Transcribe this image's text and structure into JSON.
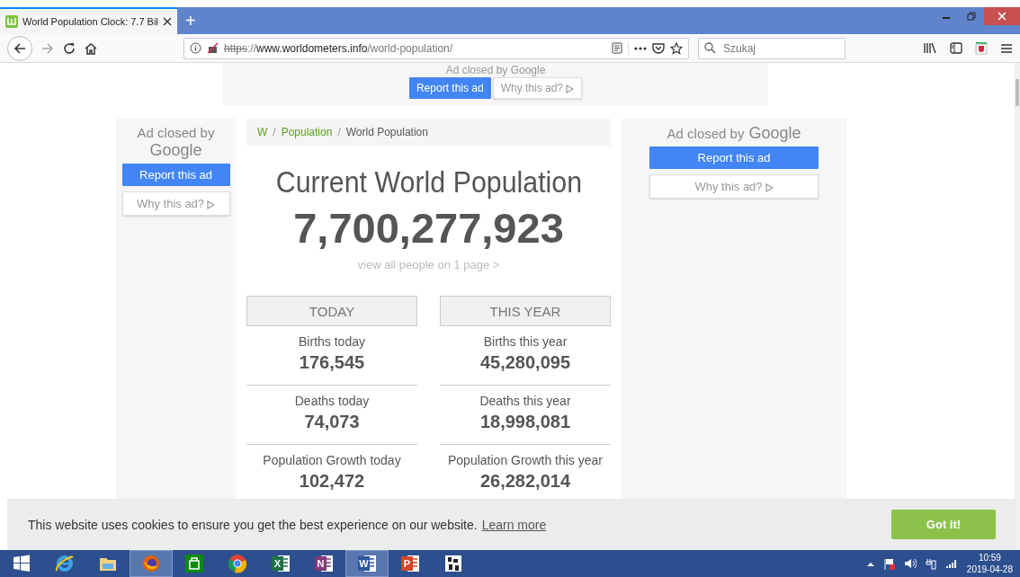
{
  "browser": {
    "tabs": [
      {
        "title": "World Population Clock: 7.7 Bil",
        "selected": true
      }
    ],
    "new_tab": "+",
    "url": {
      "scheme": "https",
      "separator": "://",
      "host": "www.worldometers.info",
      "path": "/world-population/"
    },
    "search": {
      "placeholder": "Szukaj"
    }
  },
  "top_ad": {
    "text": "Ad closed by Google",
    "report": "Report this ad",
    "why": "Why this ad?"
  },
  "left_ad": {
    "text": "Ad closed by",
    "brand": "Google",
    "report": "Report this ad",
    "why": "Why this ad?"
  },
  "breadcrumb_separator": "/",
  "breadcrumb": [
    {
      "label": "W",
      "kind": "link"
    },
    {
      "label": "Population",
      "kind": "link"
    },
    {
      "label": "World Population",
      "kind": "current"
    }
  ],
  "title": "Current World Population",
  "counter": "7,700,277,923",
  "view_all": "view all people on 1 page >",
  "columns": [
    {
      "heading": "TODAY",
      "stats": [
        {
          "label": "Births today",
          "value": "176,545"
        },
        {
          "label": "Deaths today",
          "value": "74,073"
        },
        {
          "label": "Population Growth today",
          "value": "102,472"
        }
      ]
    },
    {
      "heading": "THIS YEAR",
      "stats": [
        {
          "label": "Births this year",
          "value": "45,280,095"
        },
        {
          "label": "Deaths this year",
          "value": "18,998,081"
        },
        {
          "label": "Population Growth this year",
          "value": "26,282,014"
        }
      ]
    }
  ],
  "right_ad": {
    "text": "Ad closed by",
    "brand": "Google",
    "report": "Report this ad",
    "why": "Why this ad?"
  },
  "cookie": {
    "message": "This website uses cookies to ensure you get the best experience on our website.",
    "link": "Learn more",
    "button": "Got it!"
  },
  "taskbar": {
    "apps": [
      {
        "kind": "ie",
        "active": false
      },
      {
        "kind": "folder",
        "active": false
      },
      {
        "kind": "firefox",
        "active": true
      },
      {
        "kind": "store",
        "active": false
      },
      {
        "kind": "chrome",
        "active": false
      },
      {
        "kind": "office",
        "glyph": "X",
        "color": "#1e7145",
        "active": false
      },
      {
        "kind": "office",
        "glyph": "N",
        "color": "#80397b",
        "active": false
      },
      {
        "kind": "office",
        "glyph": "W",
        "color": "#2b579a",
        "active": true
      },
      {
        "kind": "office",
        "glyph": "P",
        "color": "#d24726",
        "active": false
      },
      {
        "kind": "grid",
        "active": false
      }
    ],
    "time": "10:59",
    "date": "2019-04-28"
  }
}
